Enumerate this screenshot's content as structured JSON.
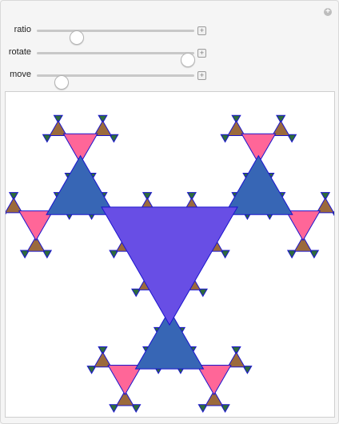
{
  "controls": [
    {
      "label": "ratio",
      "position": 0.25
    },
    {
      "label": "rotate",
      "position": 0.955
    },
    {
      "label": "move",
      "position": 0.15
    }
  ],
  "add_icon_glyph": "+",
  "colors": {
    "level0": "#684ee5",
    "level1": "#3766b5",
    "level2": "#ff6698",
    "level3": "#9b6a3c",
    "level4": "#2e6b3c",
    "stroke": "#1a14ce"
  },
  "fractal_levels": 5
}
